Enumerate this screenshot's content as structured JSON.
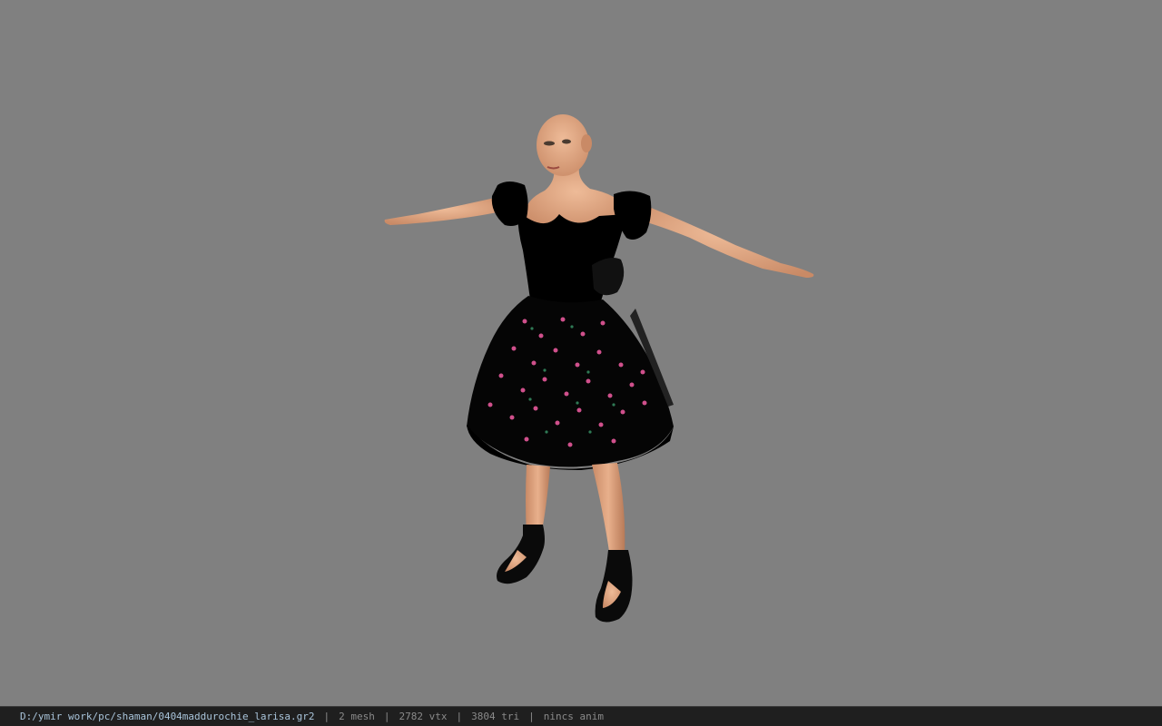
{
  "viewport": {
    "background_color": "#808080"
  },
  "model": {
    "skin_color": "#e2a784",
    "dress_color": "#000000",
    "flower_color": "#d0508c",
    "leaf_color": "#2f7a55"
  },
  "status_bar": {
    "file_path": "D:/ymir work/pc/shaman/0404maddurochie_larisa.gr2",
    "mesh_count": "2 mesh",
    "vertex_count": "2782 vtx",
    "triangle_count": "3804 tri",
    "anim_status": "nincs anim",
    "separator": "|"
  }
}
